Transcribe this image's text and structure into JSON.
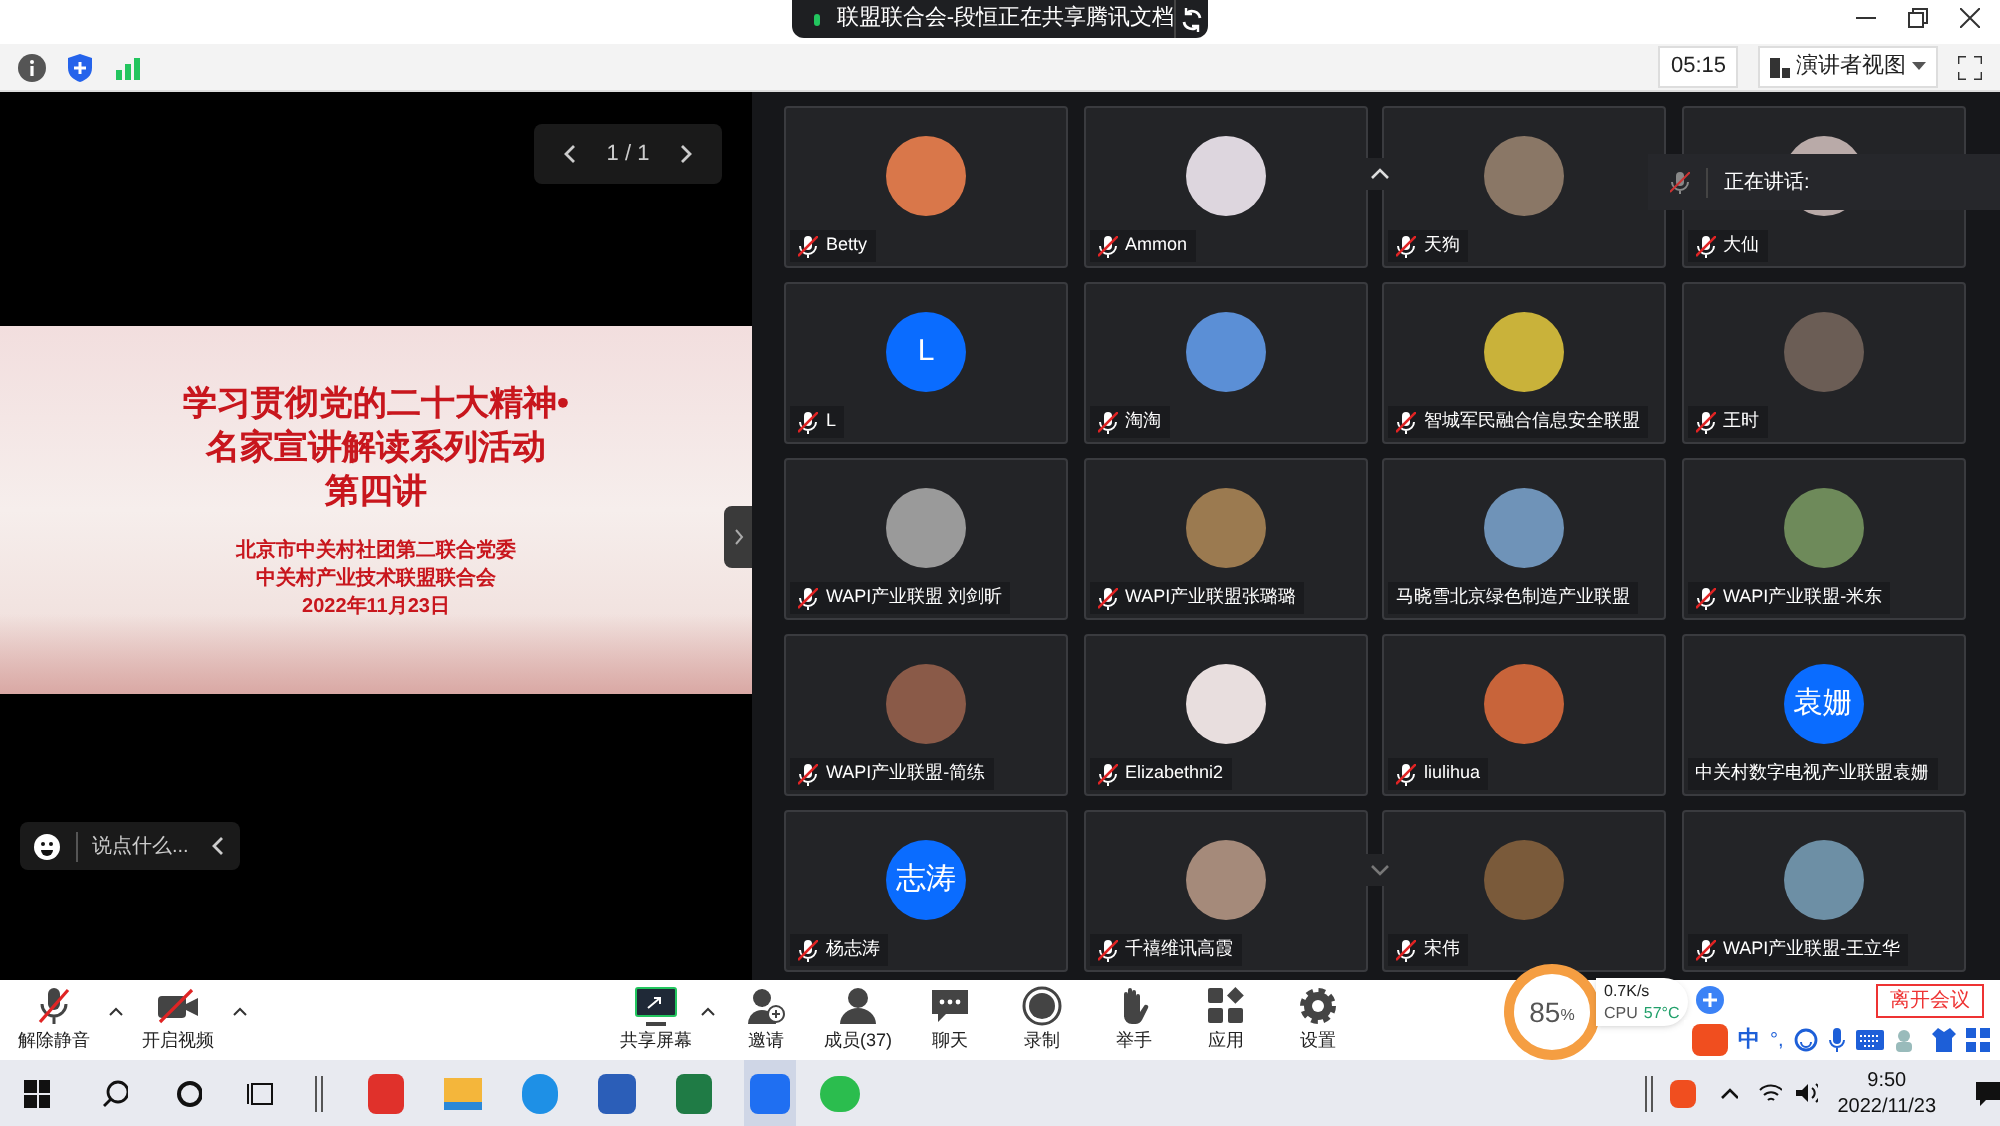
{
  "title_pill": {
    "text": "联盟联合会-段恒正在共享腾讯文档"
  },
  "top_bar": {
    "timer": "05:15",
    "view_button": "演讲者视图"
  },
  "slide": {
    "pager": "1 / 1",
    "title_lines": [
      "学习贯彻党的二十大精神•",
      "名家宣讲解读系列活动",
      "第四讲"
    ],
    "org_lines": [
      "北京市中关村社团第二联合党委",
      "中关村产业技术联盟联合会",
      "2022年11月23日"
    ]
  },
  "chat_input": {
    "placeholder": "说点什么..."
  },
  "speaking": {
    "label": "正在讲话:"
  },
  "participants": [
    {
      "name": "Betty",
      "muted": true,
      "kind": "photo",
      "color": "#d9774a"
    },
    {
      "name": "Ammon",
      "muted": true,
      "kind": "photo",
      "color": "#ddd6de"
    },
    {
      "name": "天狗",
      "muted": true,
      "kind": "photo",
      "color": "#8a7766"
    },
    {
      "name": "大仙",
      "muted": true,
      "kind": "photo",
      "color": "#b9aaa8"
    },
    {
      "name": "L",
      "muted": true,
      "kind": "initials",
      "initials": "L",
      "color": "#0a6cff"
    },
    {
      "name": "淘淘",
      "muted": true,
      "kind": "photo",
      "color": "#5b8fd6"
    },
    {
      "name": "智城军民融合信息安全联盟",
      "muted": true,
      "kind": "photo",
      "color": "#c9b23a"
    },
    {
      "name": "王时",
      "muted": true,
      "kind": "photo",
      "color": "#6b5d55"
    },
    {
      "name": "WAPI产业联盟 刘剑昕",
      "muted": true,
      "kind": "photo",
      "color": "#9a9a9a"
    },
    {
      "name": "WAPI产业联盟张璐璐",
      "muted": true,
      "kind": "photo",
      "color": "#9b7a50"
    },
    {
      "name": "马晓雪北京绿色制造产业联盟",
      "muted": false,
      "kind": "photo",
      "color": "#6f93b8"
    },
    {
      "name": "WAPI产业联盟-米东",
      "muted": true,
      "kind": "photo",
      "color": "#6e8a5a"
    },
    {
      "name": "WAPI产业联盟-简练",
      "muted": true,
      "kind": "photo",
      "color": "#8a5a48"
    },
    {
      "name": "Elizabethni2",
      "muted": true,
      "kind": "photo",
      "color": "#e8dede"
    },
    {
      "name": "liulihua",
      "muted": true,
      "kind": "photo",
      "color": "#c8643a"
    },
    {
      "name": "中关村数字电视产业联盟袁姗",
      "muted": false,
      "kind": "initials",
      "initials": "袁姗",
      "color": "#0a6cff"
    },
    {
      "name": "杨志涛",
      "muted": true,
      "kind": "initials",
      "initials": "志涛",
      "color": "#0a6cff"
    },
    {
      "name": "千禧维讯高霞",
      "muted": true,
      "kind": "photo",
      "color": "#a58a7a"
    },
    {
      "name": "宋伟",
      "muted": true,
      "kind": "photo",
      "color": "#7a5a3a"
    },
    {
      "name": "WAPI产业联盟-王立华",
      "muted": true,
      "kind": "photo",
      "color": "#6d8fa5"
    }
  ],
  "toolbar_left": [
    {
      "label": "解除静音",
      "kind": "mic"
    },
    {
      "label": "开启视频",
      "kind": "video"
    }
  ],
  "toolbar_center": [
    {
      "label": "共享屏幕",
      "kind": "share"
    },
    {
      "label": "邀请",
      "kind": "invite"
    },
    {
      "label": "成员(37)",
      "kind": "members"
    },
    {
      "label": "聊天",
      "kind": "chat"
    },
    {
      "label": "录制",
      "kind": "record"
    },
    {
      "label": "举手",
      "kind": "hand"
    },
    {
      "label": "应用",
      "kind": "apps"
    },
    {
      "label": "设置",
      "kind": "settings"
    }
  ],
  "leave_button": "离开会议",
  "monitor": {
    "percent": "85",
    "unit": "%",
    "speed": "0.7K/s",
    "cpu_label": "CPU",
    "cpu_temp": "57°C"
  },
  "ime_bar": {
    "mode": "中",
    "punct": "°,"
  },
  "taskbar": {
    "time": "9:50",
    "date": "2022/11/23"
  }
}
